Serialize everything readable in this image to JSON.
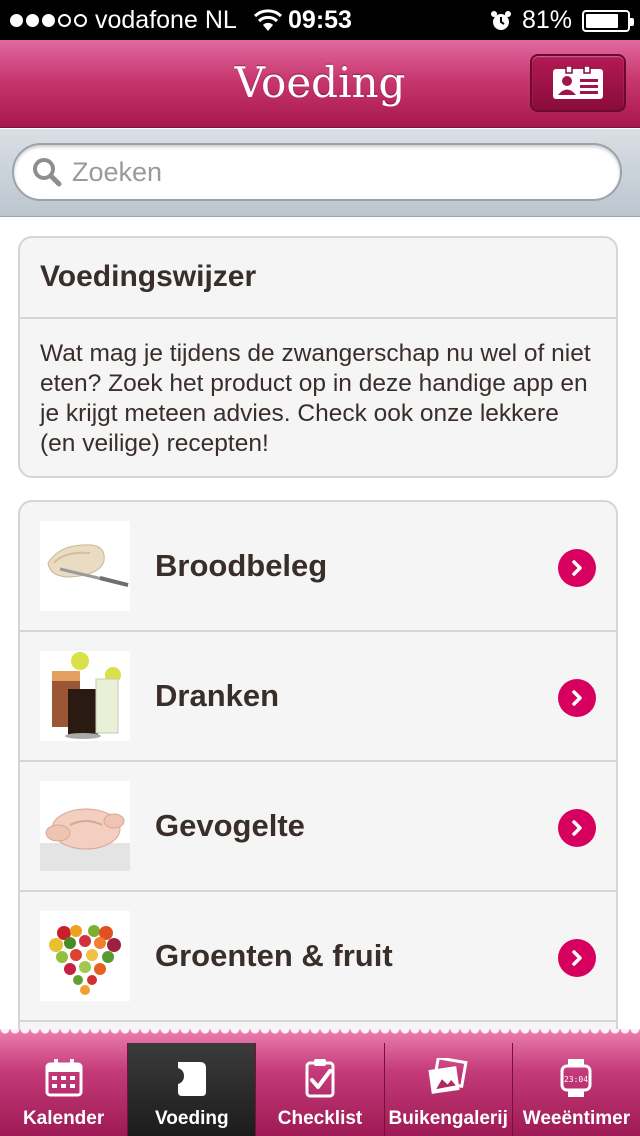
{
  "status_bar": {
    "carrier": "vodafone NL",
    "time": "09:53",
    "battery": "81%",
    "signal_bars_filled": 3,
    "signal_bars_total": 5,
    "battery_level": 0.81
  },
  "header": {
    "title": "Voeding",
    "profile_icon": "id-card-icon"
  },
  "search": {
    "placeholder": "Zoeken",
    "value": ""
  },
  "info_card": {
    "title": "Voedingswijzer",
    "body": "Wat mag je tijdens de zwangerschap nu wel of niet eten? Zoek het product op in deze handige app en je krijgt meteen advies. Check ook onze lekkere (en veilige) recepten!"
  },
  "categories": [
    {
      "label": "Broodbeleg",
      "thumb": "bread-knife-image"
    },
    {
      "label": "Dranken",
      "thumb": "drinks-image"
    },
    {
      "label": "Gevogelte",
      "thumb": "raw-chicken-image"
    },
    {
      "label": "Groenten & fruit",
      "thumb": "fruit-heart-image"
    }
  ],
  "tab_bar": {
    "tabs": [
      {
        "label": "Kalender",
        "icon": "calendar-icon",
        "active": false
      },
      {
        "label": "Voeding",
        "icon": "food-icon",
        "active": true
      },
      {
        "label": "Checklist",
        "icon": "checklist-icon",
        "active": false
      },
      {
        "label": "Buikengalerij",
        "icon": "photos-icon",
        "active": false
      },
      {
        "label": "Weeëntimer",
        "icon": "watch-icon",
        "active": false
      }
    ]
  },
  "colors": {
    "accent": "#d8005f",
    "navbar": "#c8376f",
    "text": "#3a2e2a"
  }
}
